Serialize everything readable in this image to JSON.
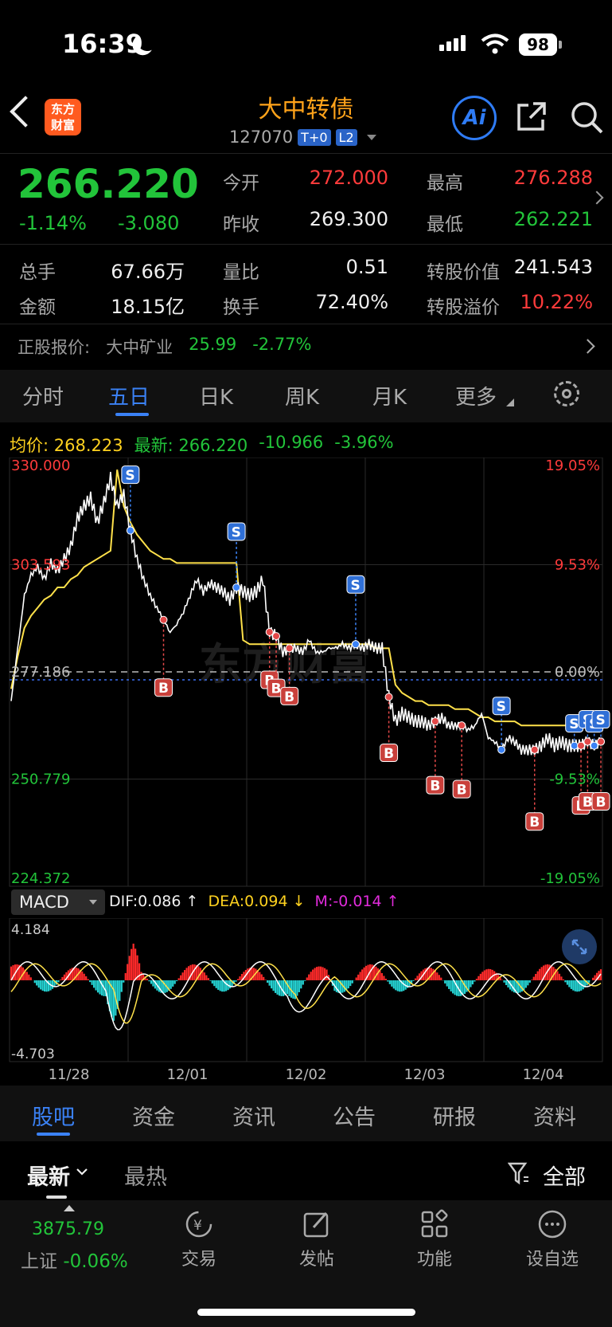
{
  "status": {
    "time": "16:39",
    "battery": "98"
  },
  "header": {
    "logo_line1": "东方",
    "logo_line2": "财富",
    "title": "大中转债",
    "code": "127070",
    "tag1": "T+0",
    "tag2": "L2",
    "ai_label": "Ai"
  },
  "quote": {
    "price": "266.220",
    "change_pct": "-1.14%",
    "change_abs": "-3.080",
    "open_label": "今开",
    "open": "272.000",
    "high_label": "最高",
    "high": "276.288",
    "prev_label": "昨收",
    "prev": "269.300",
    "low_label": "最低",
    "low": "262.221",
    "vol_label": "总手",
    "vol": "67.66万",
    "ratio_label": "量比",
    "ratio": "0.51",
    "conv_label": "转股价值",
    "conv": "241.543",
    "amt_label": "金额",
    "amt": "18.15亿",
    "turn_label": "换手",
    "turn": "72.40%",
    "prem_label": "转股溢价",
    "prem": "10.22%"
  },
  "stock": {
    "label": "正股报价:",
    "name": "大中矿业",
    "price": "25.99",
    "pct": "-2.77%"
  },
  "ktabs": [
    "分时",
    "五日",
    "日K",
    "周K",
    "月K",
    "更多"
  ],
  "chart_info": {
    "avg_label": "均价:",
    "avg": "268.223",
    "latest_label": "最新:",
    "latest": "266.220",
    "chg": "-10.966",
    "pct": "-3.96%"
  },
  "chart_data": {
    "type": "line",
    "y_left_ticks": [
      "330.000",
      "303.593",
      "277.186",
      "250.779",
      "224.372"
    ],
    "y_right_ticks": [
      "19.05%",
      "9.53%",
      "0.00%",
      "-9.53%",
      "-19.05%"
    ],
    "x_ticks": [
      "11/28",
      "12/01",
      "12/02",
      "12/03",
      "12/04"
    ],
    "ylim": [
      224.372,
      330.0
    ],
    "ref_price": 277.186,
    "price_series": [
      270,
      283,
      296,
      301,
      303,
      300,
      304,
      302,
      305,
      308,
      315,
      318,
      320,
      314,
      319,
      325,
      318,
      321,
      312,
      305,
      300,
      296,
      293,
      290,
      287,
      289,
      292,
      296,
      300,
      297,
      299,
      298,
      297,
      295,
      298,
      297,
      296,
      297,
      300,
      287,
      286,
      282,
      283,
      283,
      282,
      285,
      282,
      282,
      283,
      283,
      284,
      283,
      284,
      283,
      284,
      283,
      283,
      271,
      265,
      267,
      266,
      265,
      265,
      264,
      265,
      266,
      264,
      264,
      264,
      263,
      264,
      267,
      261,
      260,
      258,
      261,
      260,
      258,
      258,
      258,
      259,
      261,
      259,
      260,
      259,
      259,
      259,
      260,
      259,
      260
    ],
    "avg_series": [
      273,
      281,
      288,
      291,
      293,
      295,
      296,
      298,
      298,
      300,
      301,
      303,
      304,
      305,
      306,
      307,
      327,
      318,
      314,
      311,
      309,
      307,
      306,
      305,
      305,
      304,
      304,
      304,
      304,
      304,
      304,
      304,
      304,
      304,
      304,
      285,
      284,
      284,
      284,
      284,
      284,
      284,
      284,
      284,
      284,
      284,
      284,
      284,
      284,
      284,
      284,
      284,
      284,
      284,
      284,
      283,
      283,
      283,
      274,
      272,
      271,
      270,
      270,
      269,
      269,
      269,
      269,
      268,
      268,
      268,
      267,
      266,
      266,
      265,
      265,
      265,
      265,
      264,
      264,
      264,
      264,
      264,
      264,
      264,
      264,
      264,
      264,
      264,
      264,
      264
    ],
    "macd": {
      "dif": "0.086",
      "dea": "0.094",
      "m": "-0.014",
      "ymax": "4.184",
      "ymin": "-4.703"
    },
    "markers_sell": [
      "S",
      "S",
      "S",
      "S",
      "S",
      "S",
      "S",
      "S"
    ],
    "markers_buy": [
      "B",
      "B",
      "B",
      "B",
      "B",
      "B",
      "B",
      "B",
      "B",
      "B",
      "B"
    ]
  },
  "macd_label": "MACD",
  "btabs": [
    "股吧",
    "资金",
    "资讯",
    "公告",
    "研报",
    "资料"
  ],
  "sort": {
    "latest": "最新",
    "hot": "最热",
    "all": "全部"
  },
  "nav": {
    "index_value": "3875.79",
    "index_name": "上证",
    "index_pct": "-0.06%",
    "items": [
      "交易",
      "发帖",
      "功能",
      "设自选"
    ]
  },
  "watermark": "东方财富"
}
